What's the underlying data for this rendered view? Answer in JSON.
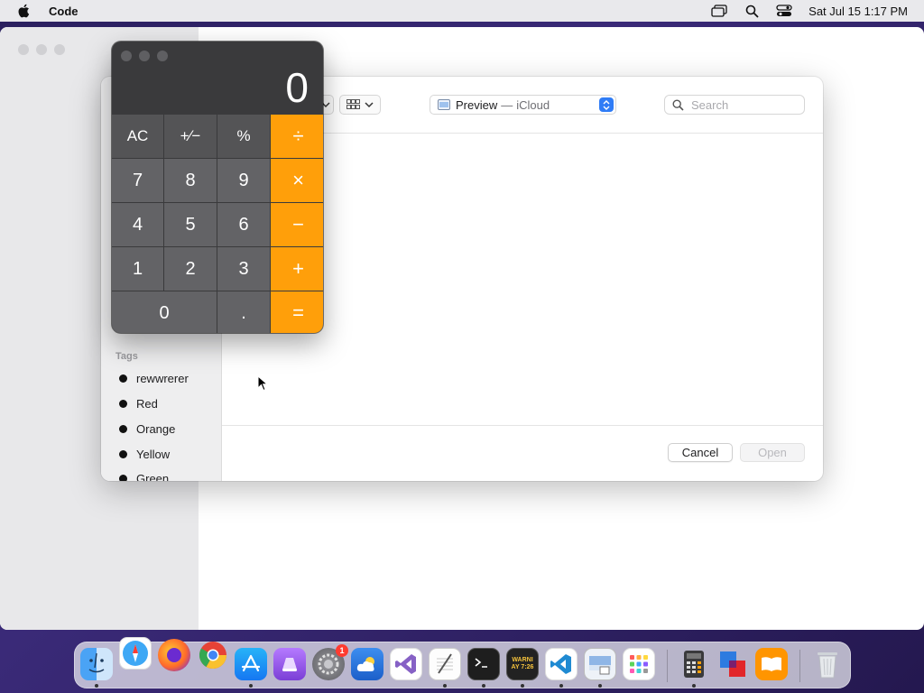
{
  "menubar": {
    "app_name": "Code",
    "datetime": "Sat Jul 15  1:17 PM"
  },
  "dialog": {
    "location": {
      "name": "Preview",
      "separator": "—",
      "sub": "iCloud"
    },
    "search": {
      "placeholder": "Search"
    },
    "tags": {
      "header": "Tags",
      "items": [
        "rewwrerer",
        "Red",
        "Orange",
        "Yellow",
        "Green"
      ]
    },
    "buttons": {
      "cancel": "Cancel",
      "open": "Open"
    }
  },
  "calculator": {
    "display": "0",
    "keys": {
      "ac": "AC",
      "plus_minus": "+⁄−",
      "percent": "%",
      "divide": "÷",
      "seven": "7",
      "eight": "8",
      "nine": "9",
      "multiply": "×",
      "four": "4",
      "five": "5",
      "six": "6",
      "minus": "−",
      "one": "1",
      "two": "2",
      "three": "3",
      "plus": "+",
      "zero": "0",
      "decimal": ".",
      "equals": "="
    }
  },
  "dock": {
    "system_settings_badge": "1",
    "console_label": "WARNI\nAY 7:26"
  },
  "colors": {
    "accent_orange": "#ff9f0a",
    "accent_blue": "#2f7cf6"
  }
}
